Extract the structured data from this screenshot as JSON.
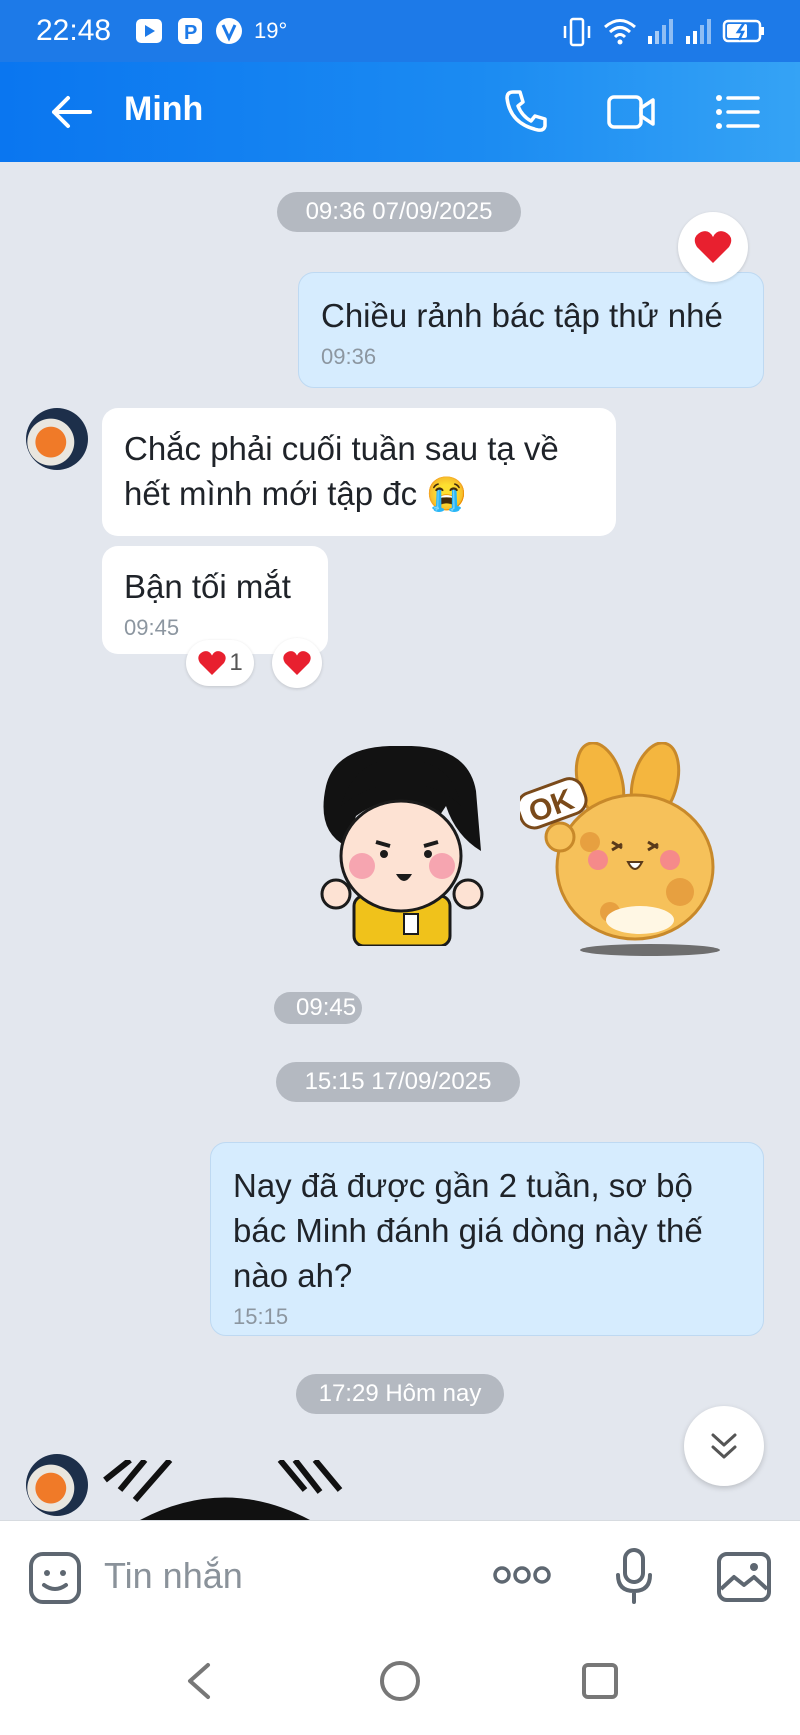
{
  "status_bar": {
    "time": "22:48",
    "temperature": "19°"
  },
  "header": {
    "contact_name": "Minh"
  },
  "chat": {
    "date_1": "09:36 07/09/2025",
    "msg_1": {
      "text": "Chiều rảnh bác tập thử nhé",
      "time": "09:36"
    },
    "msg_2": {
      "text": "Chắc phải cuối tuần sau tạ về hết mình mới tập đc 😭"
    },
    "msg_3": {
      "text": "Bận tối mắt",
      "time": "09:45",
      "reaction_count": "1"
    },
    "sticker_time": "09:45",
    "sticker_2_label": "OK",
    "date_2": "15:15 17/09/2025",
    "msg_4": {
      "text": "Nay đã được gần 2 tuần, sơ bộ bác Minh đánh giá dòng này thế nào ah?",
      "time": "15:15"
    },
    "date_3": "17:29 Hôm nay"
  },
  "composer": {
    "placeholder": "Tin nhắn"
  },
  "colors": {
    "header_blue": "#1d7ae8",
    "outgoing_bubble": "#d6ecfe",
    "heart": "#e8202f"
  }
}
